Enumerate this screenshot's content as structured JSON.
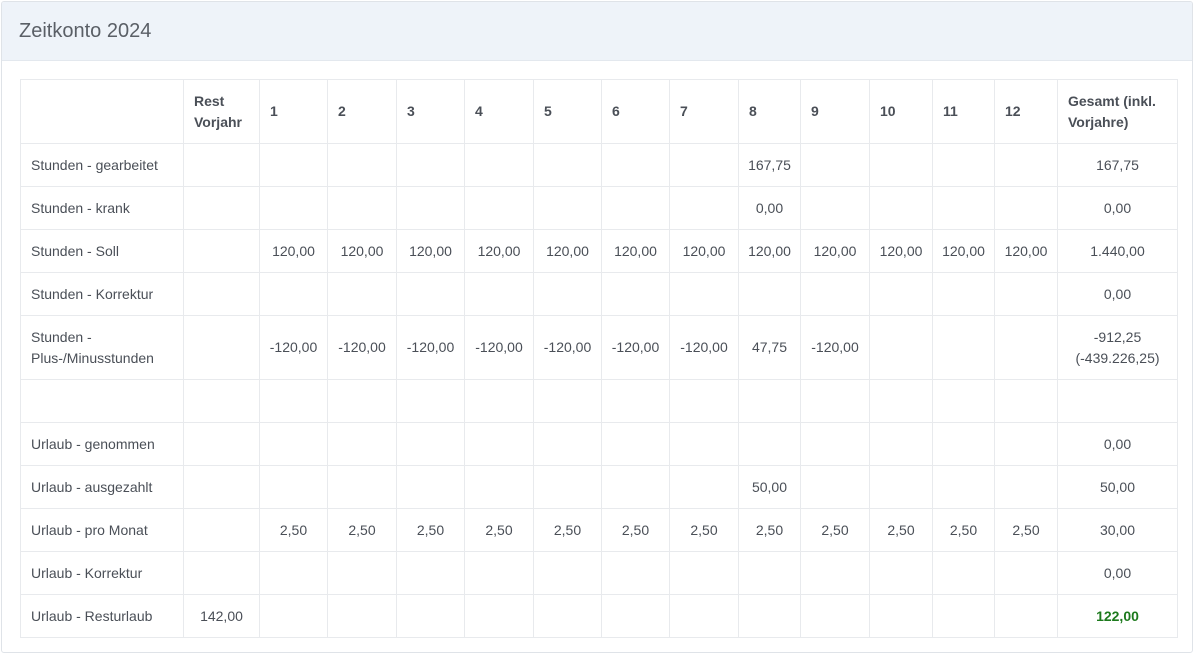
{
  "title": "Zeitkonto 2024",
  "headers": {
    "rest": "Rest Vorjahr",
    "months": [
      "1",
      "2",
      "3",
      "4",
      "5",
      "6",
      "7",
      "8",
      "9",
      "10",
      "11",
      "12"
    ],
    "total": "Gesamt (inkl. Vorjahre)"
  },
  "rows": [
    {
      "label": "Stunden - gearbeitet",
      "rest": "",
      "months": [
        "",
        "",
        "",
        "",
        "",
        "",
        "",
        "167,75",
        "",
        "",
        "",
        ""
      ],
      "total": "167,75"
    },
    {
      "label": "Stunden - krank",
      "rest": "",
      "months": [
        "",
        "",
        "",
        "",
        "",
        "",
        "",
        "0,00",
        "",
        "",
        "",
        ""
      ],
      "total": "0,00"
    },
    {
      "label": "Stunden - Soll",
      "rest": "",
      "months": [
        "120,00",
        "120,00",
        "120,00",
        "120,00",
        "120,00",
        "120,00",
        "120,00",
        "120,00",
        "120,00",
        "120,00",
        "120,00",
        "120,00"
      ],
      "total": "1.440,00"
    },
    {
      "label": "Stunden - Korrektur",
      "rest": "",
      "months": [
        "",
        "",
        "",
        "",
        "",
        "",
        "",
        "",
        "",
        "",
        "",
        ""
      ],
      "total": "0,00"
    },
    {
      "label": "Stunden - Plus-/Minusstunden",
      "rest": "",
      "months": [
        "-120,00",
        "-120,00",
        "-120,00",
        "-120,00",
        "-120,00",
        "-120,00",
        "-120,00",
        "47,75",
        "-120,00",
        "",
        "",
        ""
      ],
      "total": "-912,25 (-439.226,25)"
    },
    {
      "label": "",
      "rest": "",
      "months": [
        "",
        "",
        "",
        "",
        "",
        "",
        "",
        "",
        "",
        "",
        "",
        ""
      ],
      "total": ""
    },
    {
      "label": "Urlaub - genommen",
      "rest": "",
      "months": [
        "",
        "",
        "",
        "",
        "",
        "",
        "",
        "",
        "",
        "",
        "",
        ""
      ],
      "total": "0,00"
    },
    {
      "label": "Urlaub - ausgezahlt",
      "rest": "",
      "months": [
        "",
        "",
        "",
        "",
        "",
        "",
        "",
        "50,00",
        "",
        "",
        "",
        ""
      ],
      "total": "50,00"
    },
    {
      "label": "Urlaub - pro Monat",
      "rest": "",
      "months": [
        "2,50",
        "2,50",
        "2,50",
        "2,50",
        "2,50",
        "2,50",
        "2,50",
        "2,50",
        "2,50",
        "2,50",
        "2,50",
        "2,50"
      ],
      "total": "30,00"
    },
    {
      "label": "Urlaub - Korrektur",
      "rest": "",
      "months": [
        "",
        "",
        "",
        "",
        "",
        "",
        "",
        "",
        "",
        "",
        "",
        ""
      ],
      "total": "0,00"
    },
    {
      "label": "Urlaub - Resturlaub",
      "rest": "142,00",
      "months": [
        "",
        "",
        "",
        "",
        "",
        "",
        "",
        "",
        "",
        "",
        "",
        ""
      ],
      "total": "122,00"
    }
  ],
  "colors": {
    "header_bg": "#eef3f9",
    "positive_total": "#1d7a1d"
  }
}
